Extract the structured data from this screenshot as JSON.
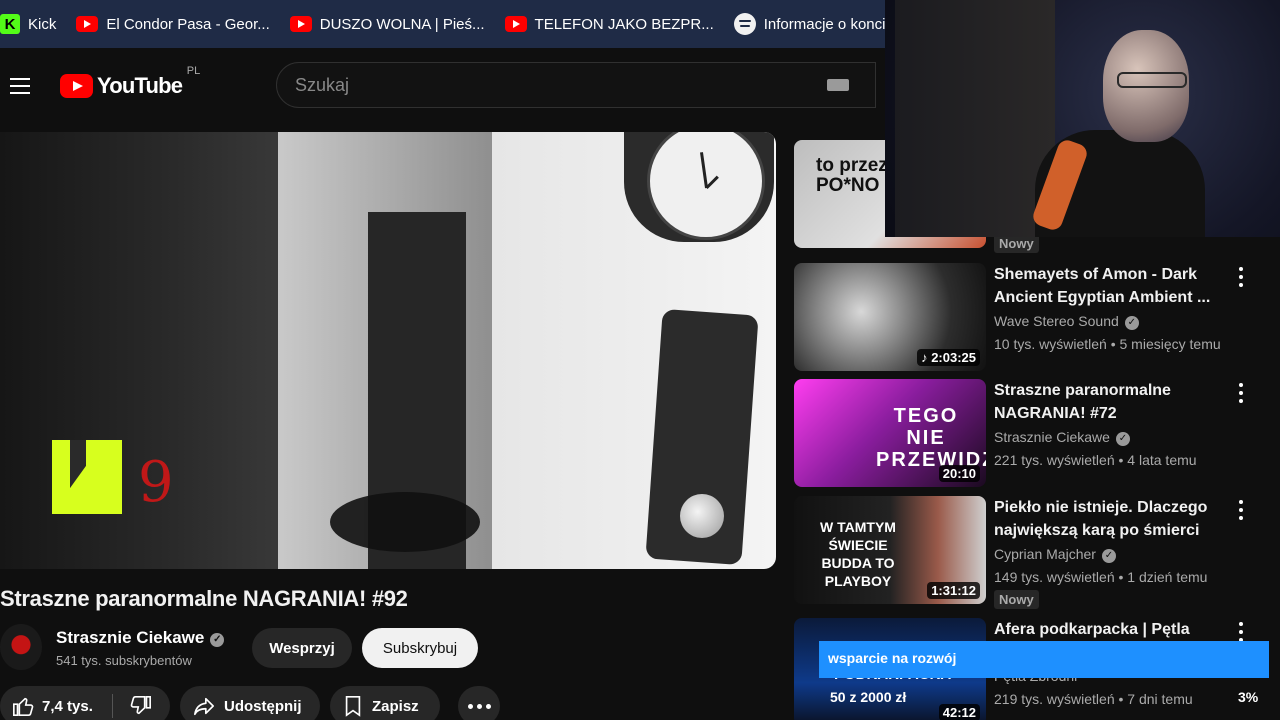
{
  "bookmarks": [
    {
      "label": "Kick",
      "icon": "kick-icon"
    },
    {
      "label": "El Condor Pasa - Geor...",
      "icon": "youtube-icon"
    },
    {
      "label": "DUSZO WOLNA | Pieś...",
      "icon": "youtube-icon"
    },
    {
      "label": "TELEFON JAKO BEZPR...",
      "icon": "youtube-icon"
    },
    {
      "label": "Informacje o koncie -",
      "icon": "spotify-icon"
    }
  ],
  "header": {
    "logo_text": "YouTube",
    "country": "PL",
    "search_placeholder": "Szukaj"
  },
  "player": {
    "overlay_number": "9"
  },
  "video": {
    "title": "Straszne paranormalne NAGRANIA! #92",
    "channel_name": "Strasznie Ciekawe",
    "subscribers": "541 tys. subskrybentów",
    "support_label": "Wesprzyj",
    "subscribe_label": "Subskrybuj",
    "likes": "7,4 tys.",
    "share_label": "Udostępnij",
    "save_label": "Zapisz"
  },
  "recommendations": [
    {
      "title": "",
      "channel": "",
      "meta": "",
      "thumb_text": "to przez PO*NO",
      "badge": "Nowy"
    },
    {
      "title": "Shemayets of Amon - Dark Ancient Egyptian Ambient ...",
      "channel": "Wave Stereo Sound",
      "meta": "10 tys. wyświetleń • 5 miesięcy temu",
      "duration": "2:03:25"
    },
    {
      "title": "Straszne paranormalne NAGRANIA! #72",
      "channel": "Strasznie Ciekawe",
      "meta": "221 tys. wyświetleń • 4 lata temu",
      "duration": "20:10",
      "thumb_text": "TEGO NIE PRZEWIDZIELI"
    },
    {
      "title": "Piekło nie istnieje. Dlaczego największą karą po śmierci jes...",
      "channel": "Cyprian Majcher",
      "meta": "149 tys. wyświetleń • 1 dzień temu",
      "duration": "1:31:12",
      "badge": "Nowy",
      "thumb_text": "W TAMTYM ŚWIECIE BUDDA TO PLAYBOY"
    },
    {
      "title": "Afera podkarpacka | Pętla Zbrodni",
      "channel": "Pętla Zbrodni",
      "meta": "219 tys. wyświetleń • 7 dni temu",
      "duration": "42:12",
      "thumb_text": "PODKARPACKA"
    }
  ],
  "donation": {
    "text": "wsparcie na rozwój",
    "amount": "50 z 2000 zł",
    "percent": "3%"
  },
  "colors": {
    "background": "#0f0f0f",
    "bookmarks_bar": "#1f2b46",
    "brand_red": "#ff0000",
    "donation_blue": "#1e90ff"
  }
}
